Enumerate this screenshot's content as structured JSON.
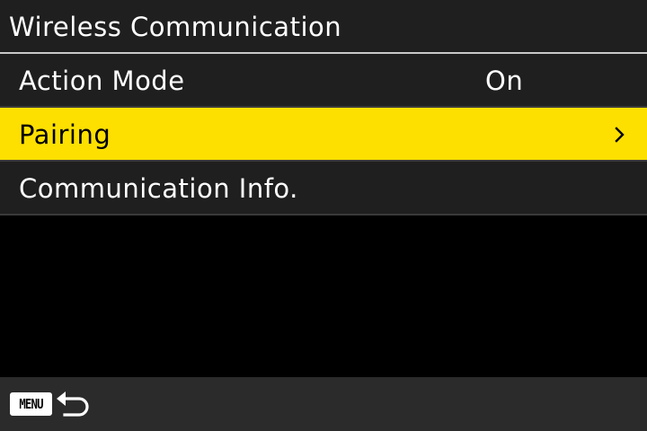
{
  "header": {
    "title": "Wireless Communication"
  },
  "menu": {
    "items": [
      {
        "label": "Action Mode",
        "value": "On",
        "selected": false
      },
      {
        "label": "Pairing",
        "value": "",
        "selected": true,
        "icon": "chevron-right-icon"
      },
      {
        "label": "Communication Info.",
        "value": "",
        "selected": false
      }
    ]
  },
  "footer": {
    "menu_button_label": "MENU",
    "back_icon": "return-arrow-icon"
  },
  "colors": {
    "highlight": "#fde000",
    "row_background": "#1f1f1f",
    "screen_background": "#000000",
    "footer_background": "#2b2b2b",
    "text": "#ffffff"
  }
}
